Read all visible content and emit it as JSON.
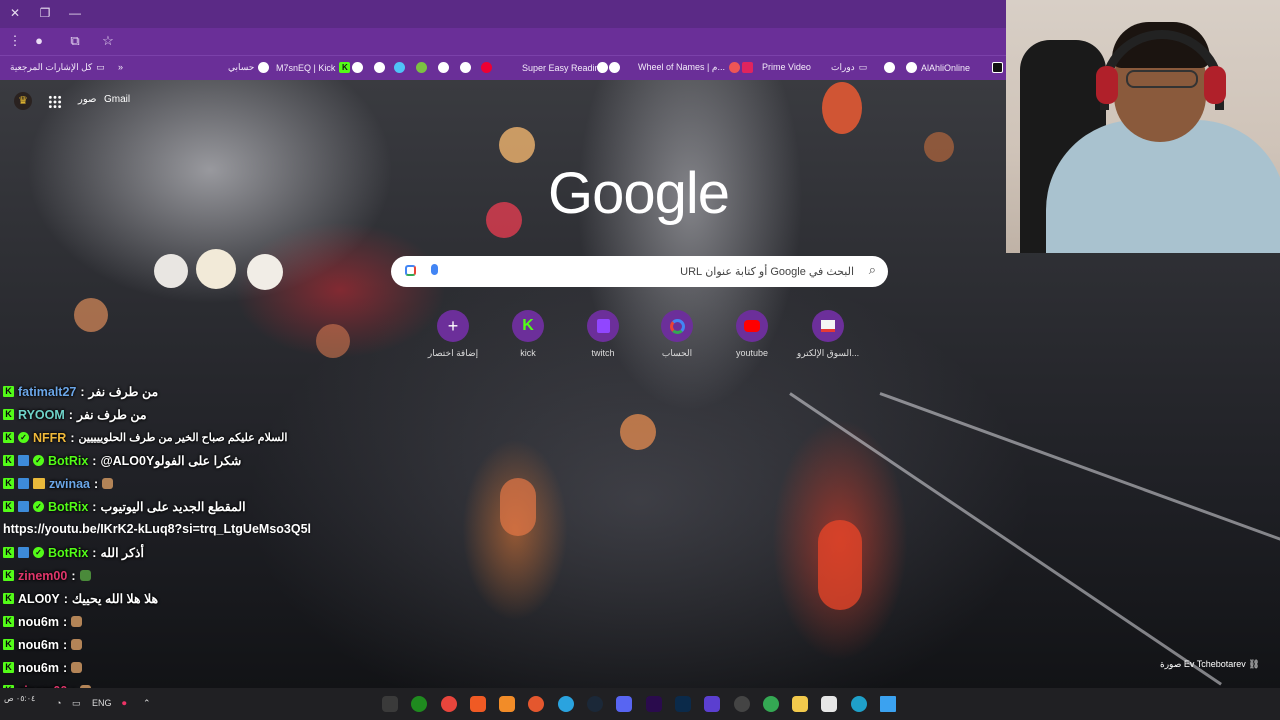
{
  "browser": {
    "bookmarks": [
      {
        "label": "AlAhliOnline"
      },
      {
        "label": "دورات"
      },
      {
        "label": "Prime Video"
      },
      {
        "label": "Wheel of Names | م..."
      },
      {
        "label": "Super Easy Reading"
      },
      {
        "label": "M7snEQ | Kick"
      },
      {
        "label": "حسابي"
      },
      {
        "label": "كل الإشارات المرجعية"
      }
    ]
  },
  "google": {
    "gmail_label": "Gmail",
    "images_label": "صور",
    "logo": "Google",
    "search_placeholder": "البحث في Google أو كتابة عنوان URL",
    "shortcuts": [
      {
        "label": "السوق الإلكترو...",
        "icon": "store-icon"
      },
      {
        "label": "youtube",
        "icon": "youtube-icon"
      },
      {
        "label": "الحساب",
        "icon": "google-icon"
      },
      {
        "label": "twitch",
        "icon": "twitch-icon"
      },
      {
        "label": "kick",
        "icon": "kick-icon"
      },
      {
        "label": "إضافة اختصار",
        "icon": "plus-icon"
      }
    ],
    "photo_credit": "صورة Ev Tchebotarev"
  },
  "chat": [
    {
      "user": "fatimalt27",
      "color": "#6ba6e8",
      "text": "من طرف نفر",
      "badges": [
        "k"
      ]
    },
    {
      "user": "RYOOM",
      "color": "#6fd3c9",
      "text": "من طرف نفر",
      "badges": [
        "k"
      ]
    },
    {
      "user": "NFFR",
      "color": "#f0b93a",
      "text": "السلام عليكم صباح الخير من طرف الحلوييييين",
      "badges": [
        "k",
        "v"
      ]
    },
    {
      "user": "BotRix",
      "color": "#53fc18",
      "text": "@ALO0Yشكرا على الفولو",
      "badges": [
        "k",
        "m",
        "v"
      ]
    },
    {
      "user": "zwinaa",
      "color": "#6ba6e8",
      "text": "",
      "badges": [
        "k",
        "m",
        "g"
      ]
    },
    {
      "user": "BotRix",
      "color": "#53fc18",
      "text": "المقطع الجديد على اليوتيوب",
      "badges": [
        "k",
        "m",
        "v"
      ]
    },
    {
      "link": "https://youtu.be/IKrK2-kLuq8?si=trq_LtgUeMso3Q5l"
    },
    {
      "user": "BotRix",
      "color": "#53fc18",
      "text": "أذكر الله",
      "badges": [
        "k",
        "m",
        "v"
      ]
    },
    {
      "user": "zinem00",
      "color": "#e0366b",
      "text": "",
      "badges": [
        "k"
      ]
    },
    {
      "user": "ALO0Y",
      "color": "#ffffff",
      "text": "هلا هلا الله يحييك",
      "badges": [
        "k"
      ]
    },
    {
      "user": "nou6m",
      "color": "#ffffff",
      "text": "",
      "badges": [
        "k"
      ]
    },
    {
      "user": "nou6m",
      "color": "#ffffff",
      "text": "",
      "badges": [
        "k"
      ]
    },
    {
      "user": "nou6m",
      "color": "#ffffff",
      "text": "",
      "badges": [
        "k"
      ]
    },
    {
      "user": "zinem00",
      "color": "#e0366b",
      "text": "",
      "badges": [
        "k"
      ]
    }
  ],
  "taskbar": {
    "lang": "ENG",
    "time": "٠٥:٠٤ ص"
  }
}
